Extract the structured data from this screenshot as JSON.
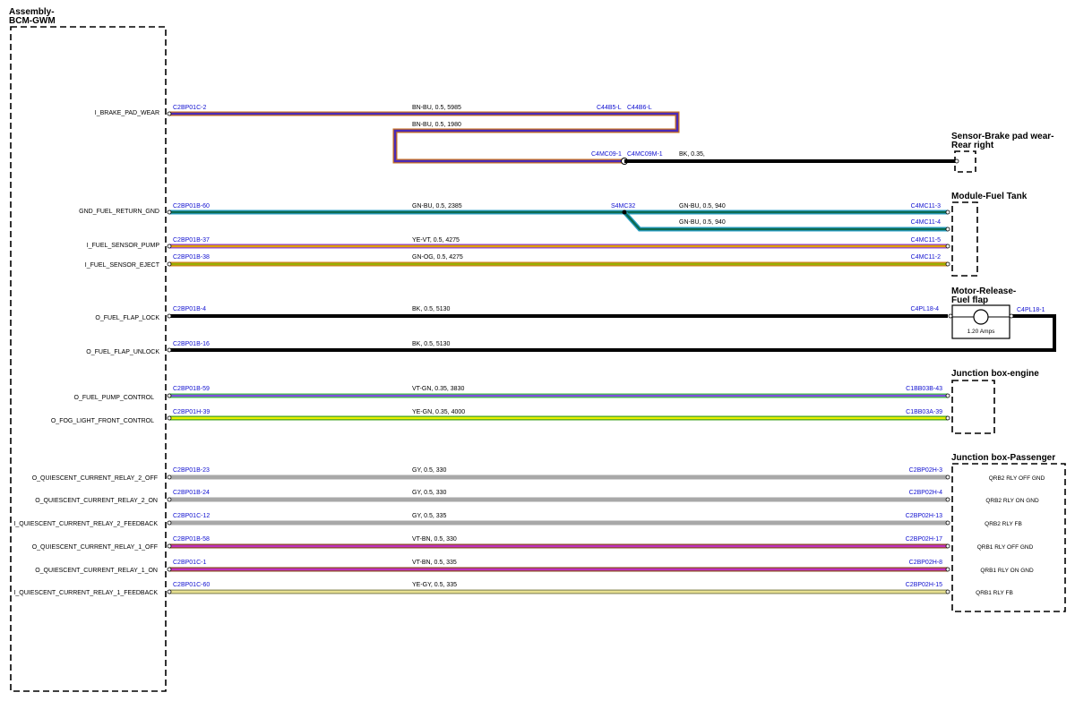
{
  "module": {
    "title_line1": "Assembly-",
    "title_line2": "BCM-GWM"
  },
  "components": {
    "brake_sensor": {
      "line1": "Sensor-Brake pad wear-",
      "line2": "Rear right"
    },
    "fuel_tank": {
      "title": "Module-Fuel Tank"
    },
    "fuel_flap": {
      "line1": "Motor-Release-",
      "line2": "Fuel flap",
      "rating": "1.20 Amps"
    },
    "jb_engine": {
      "title": "Junction box-engine"
    },
    "jb_passenger": {
      "title": "Junction box-Passenger"
    }
  },
  "circuits": [
    {
      "pin": "I_BRAKE_PAD_WEAR",
      "from": "C2BP01C-2",
      "wire": "BN-BU,  0.5,  5985",
      "colors": [
        "#4a2ab8",
        "#c87020"
      ]
    },
    {
      "pin": "GND_FUEL_RETURN_GND",
      "from": "C2BP01B-60",
      "wire": "GN-BU,  0.5,  2385",
      "to": "C4MC11-3",
      "colors": [
        "#0d6b50",
        "#2ba0c8"
      ]
    },
    {
      "pin": "I_FUEL_SENSOR_PUMP",
      "from": "C2BP01B-37",
      "wire": "YE-VT,  0.5,  4275",
      "to": "C4MC11-5",
      "colors": [
        "#e0a000",
        "#9040d0"
      ]
    },
    {
      "pin": "I_FUEL_SENSOR_EJECT",
      "from": "C2BP01B-38",
      "wire": "GN-OG,  0.5,  4275",
      "to": "C4MC11-2",
      "colors": [
        "#9ab000",
        "#d08020"
      ]
    },
    {
      "pin": "O_FUEL_FLAP_LOCK",
      "from": "C2BP01B-4",
      "wire": "BK,  0.5,  5130",
      "to": "C4PL18-4",
      "colors": [
        "#000000",
        "#000000"
      ]
    },
    {
      "pin": "O_FUEL_FLAP_UNLOCK",
      "from": "C2BP01B-16",
      "wire": "BK,  0.5,  5130",
      "colors": [
        "#000000",
        "#000000"
      ]
    },
    {
      "pin": "O_FUEL_PUMP_CONTROL",
      "from": "C2BP01B-59",
      "wire": "VT-GN,  0.35,  3830",
      "to": "C1BB03B-43",
      "colors": [
        "#8050e0",
        "#40c040"
      ]
    },
    {
      "pin": "O_FOG_LIGHT_FRONT_CONTROL",
      "from": "C2BP01H-39",
      "wire": "YE-GN,  0.35,  4000",
      "to": "C1BB03A-39",
      "colors": [
        "#e8f000",
        "#40a020"
      ]
    },
    {
      "pin": "O_QUIESCENT_CURRENT_RELAY_2_OFF",
      "from": "C2BP01B-23",
      "wire": "GY,  0.5,  330",
      "to": "C2BP02H-3",
      "dest": "QRB2 RLY OFF GND",
      "colors": [
        "#a8a8a8",
        "#a8a8a8"
      ]
    },
    {
      "pin": "O_QUIESCENT_CURRENT_RELAY_2_ON",
      "from": "C2BP01B-24",
      "wire": "GY,  0.5,  330",
      "to": "C2BP02H-4",
      "dest": "QRB2 RLY ON GND",
      "colors": [
        "#a8a8a8",
        "#a8a8a8"
      ]
    },
    {
      "pin": "I_QUIESCENT_CURRENT_RELAY_2_FEEDBACK",
      "from": "C2BP01C-12",
      "wire": "GY,  0.5,  335",
      "to": "C2BP02H-13",
      "dest": "QRB2 RLY FB",
      "colors": [
        "#a8a8a8",
        "#a8a8a8"
      ]
    },
    {
      "pin": "O_QUIESCENT_CURRENT_RELAY_1_OFF",
      "from": "C2BP01B-58",
      "wire": "VT-BN,  0.5,  330",
      "to": "C2BP02H-17",
      "dest": "QRB1 RLY OFF GND",
      "colors": [
        "#c030c0",
        "#8a4a20"
      ]
    },
    {
      "pin": "O_QUIESCENT_CURRENT_RELAY_1_ON",
      "from": "C2BP01C-1",
      "wire": "VT-BN,  0.5,  335",
      "to": "C2BP02H-8",
      "dest": "QRB1 RLY ON GND",
      "colors": [
        "#c030c0",
        "#8a4a20"
      ]
    },
    {
      "pin": "I_QUIESCENT_CURRENT_RELAY_1_FEEDBACK",
      "from": "C2BP01C-60",
      "wire": "YE-GY,  0.5,  335",
      "to": "C2BP02H-15",
      "dest": "QRB1 RLY FB",
      "colors": [
        "#e8e090",
        "#909060"
      ]
    }
  ],
  "extra_wires": {
    "brake_return": "BN-BU,  0.5,  1980",
    "brake_bk": "BK,  0.35,",
    "fuel_return_branch": "GN-BU,  0.5,  940",
    "fuel_return_branch2": "GN-BU,  0.5,  940"
  },
  "connectors": {
    "c44b5": "C44B5-L",
    "c44b6": "C44B6-L",
    "c4mc09": "C4MC09-1",
    "c4mc09m": "C4MC09M-1",
    "s4mc32": "S4MC32",
    "c4mc11_4": "C4MC11-4",
    "c4pl18_1": "C4PL18-1"
  }
}
